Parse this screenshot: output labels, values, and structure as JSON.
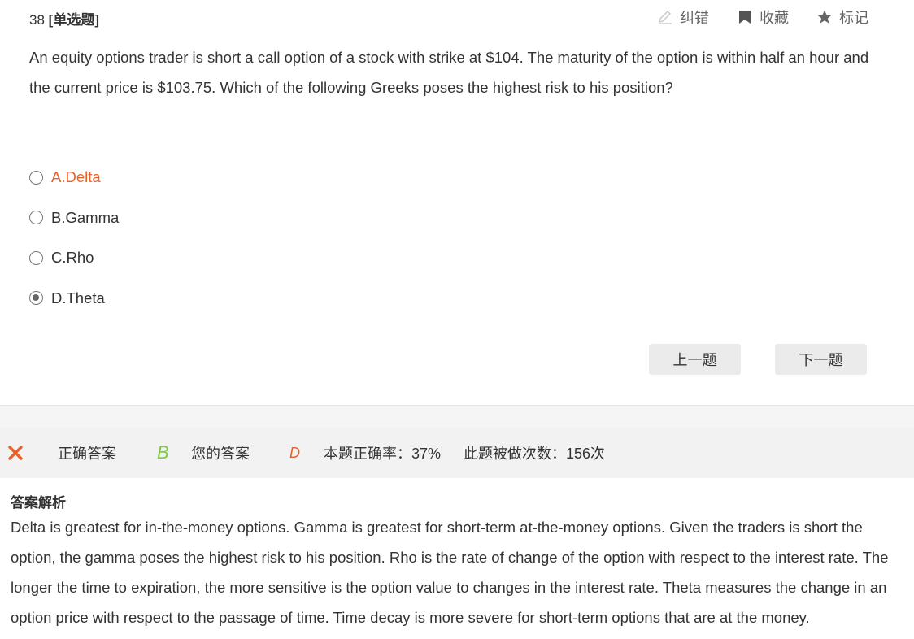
{
  "question": {
    "number": "38",
    "type": "[单选题]",
    "text": "An equity options trader is short a call option of a stock with strike at $104. The maturity of the option is within half an hour and the current price is $103.75. Which of the following Greeks poses the highest risk to his position?"
  },
  "tools": {
    "report_label": "纠错",
    "favorite_label": "收藏",
    "mark_label": "标记"
  },
  "options": [
    {
      "label": "A.Delta",
      "selected": false,
      "highlighted": true
    },
    {
      "label": "B.Gamma",
      "selected": false,
      "highlighted": false
    },
    {
      "label": "C.Rho",
      "selected": false,
      "highlighted": false
    },
    {
      "label": "D.Theta",
      "selected": true,
      "highlighted": false
    }
  ],
  "nav": {
    "prev_label": "上一题",
    "next_label": "下一题"
  },
  "result": {
    "status_icon": "x-icon",
    "correct_answer_label": "正确答案",
    "correct_answer_value": "B",
    "your_answer_label": "您的答案",
    "your_answer_value": "D",
    "accuracy_text": "本题正确率：37%",
    "attempts_text": "此题被做次数：156次"
  },
  "explanation": {
    "title": "答案解析",
    "text": "Delta is greatest for in-the-money options. Gamma is greatest for short-term at-the-money options. Given the traders is short the option, the gamma poses the highest risk to his position. Rho is the rate of change of the option with respect to the interest rate. The longer the time to expiration, the more sensitive is the option value to changes in the interest rate. Theta measures the change in an option price with respect to the passage of time. Time decay is more severe for short-term options that are at the money."
  },
  "colors": {
    "accent_orange": "#e8602c",
    "correct_green": "#7ac943",
    "button_gray": "#ebebeb"
  }
}
